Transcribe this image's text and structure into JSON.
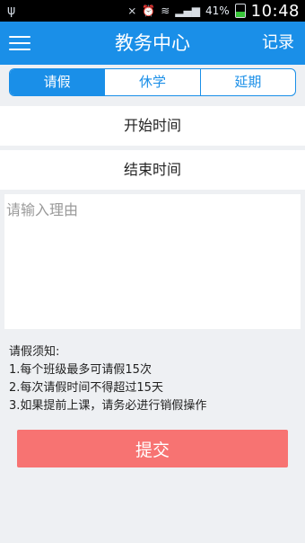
{
  "status_bar": {
    "usb_icon": "usb-icon",
    "battery_percent": "41%",
    "time": "10:48"
  },
  "app_bar": {
    "title": "教务中心",
    "record_label": "记录"
  },
  "tabs": [
    {
      "label": "请假",
      "active": true
    },
    {
      "label": "休学",
      "active": false
    },
    {
      "label": "延期",
      "active": false
    }
  ],
  "form": {
    "start_time_label": "开始时间",
    "end_time_label": "结束时间",
    "reason_placeholder": "请输入理由"
  },
  "notice": {
    "title": "请假须知:",
    "items": [
      "1.每个班级最多可请假15次",
      "2.每次请假时间不得超过15天",
      "3.如果提前上课，请务必进行销假操作"
    ]
  },
  "submit_label": "提交",
  "colors": {
    "primary": "#1a8fe8",
    "submit": "#f77372",
    "background": "#eef0f3"
  }
}
